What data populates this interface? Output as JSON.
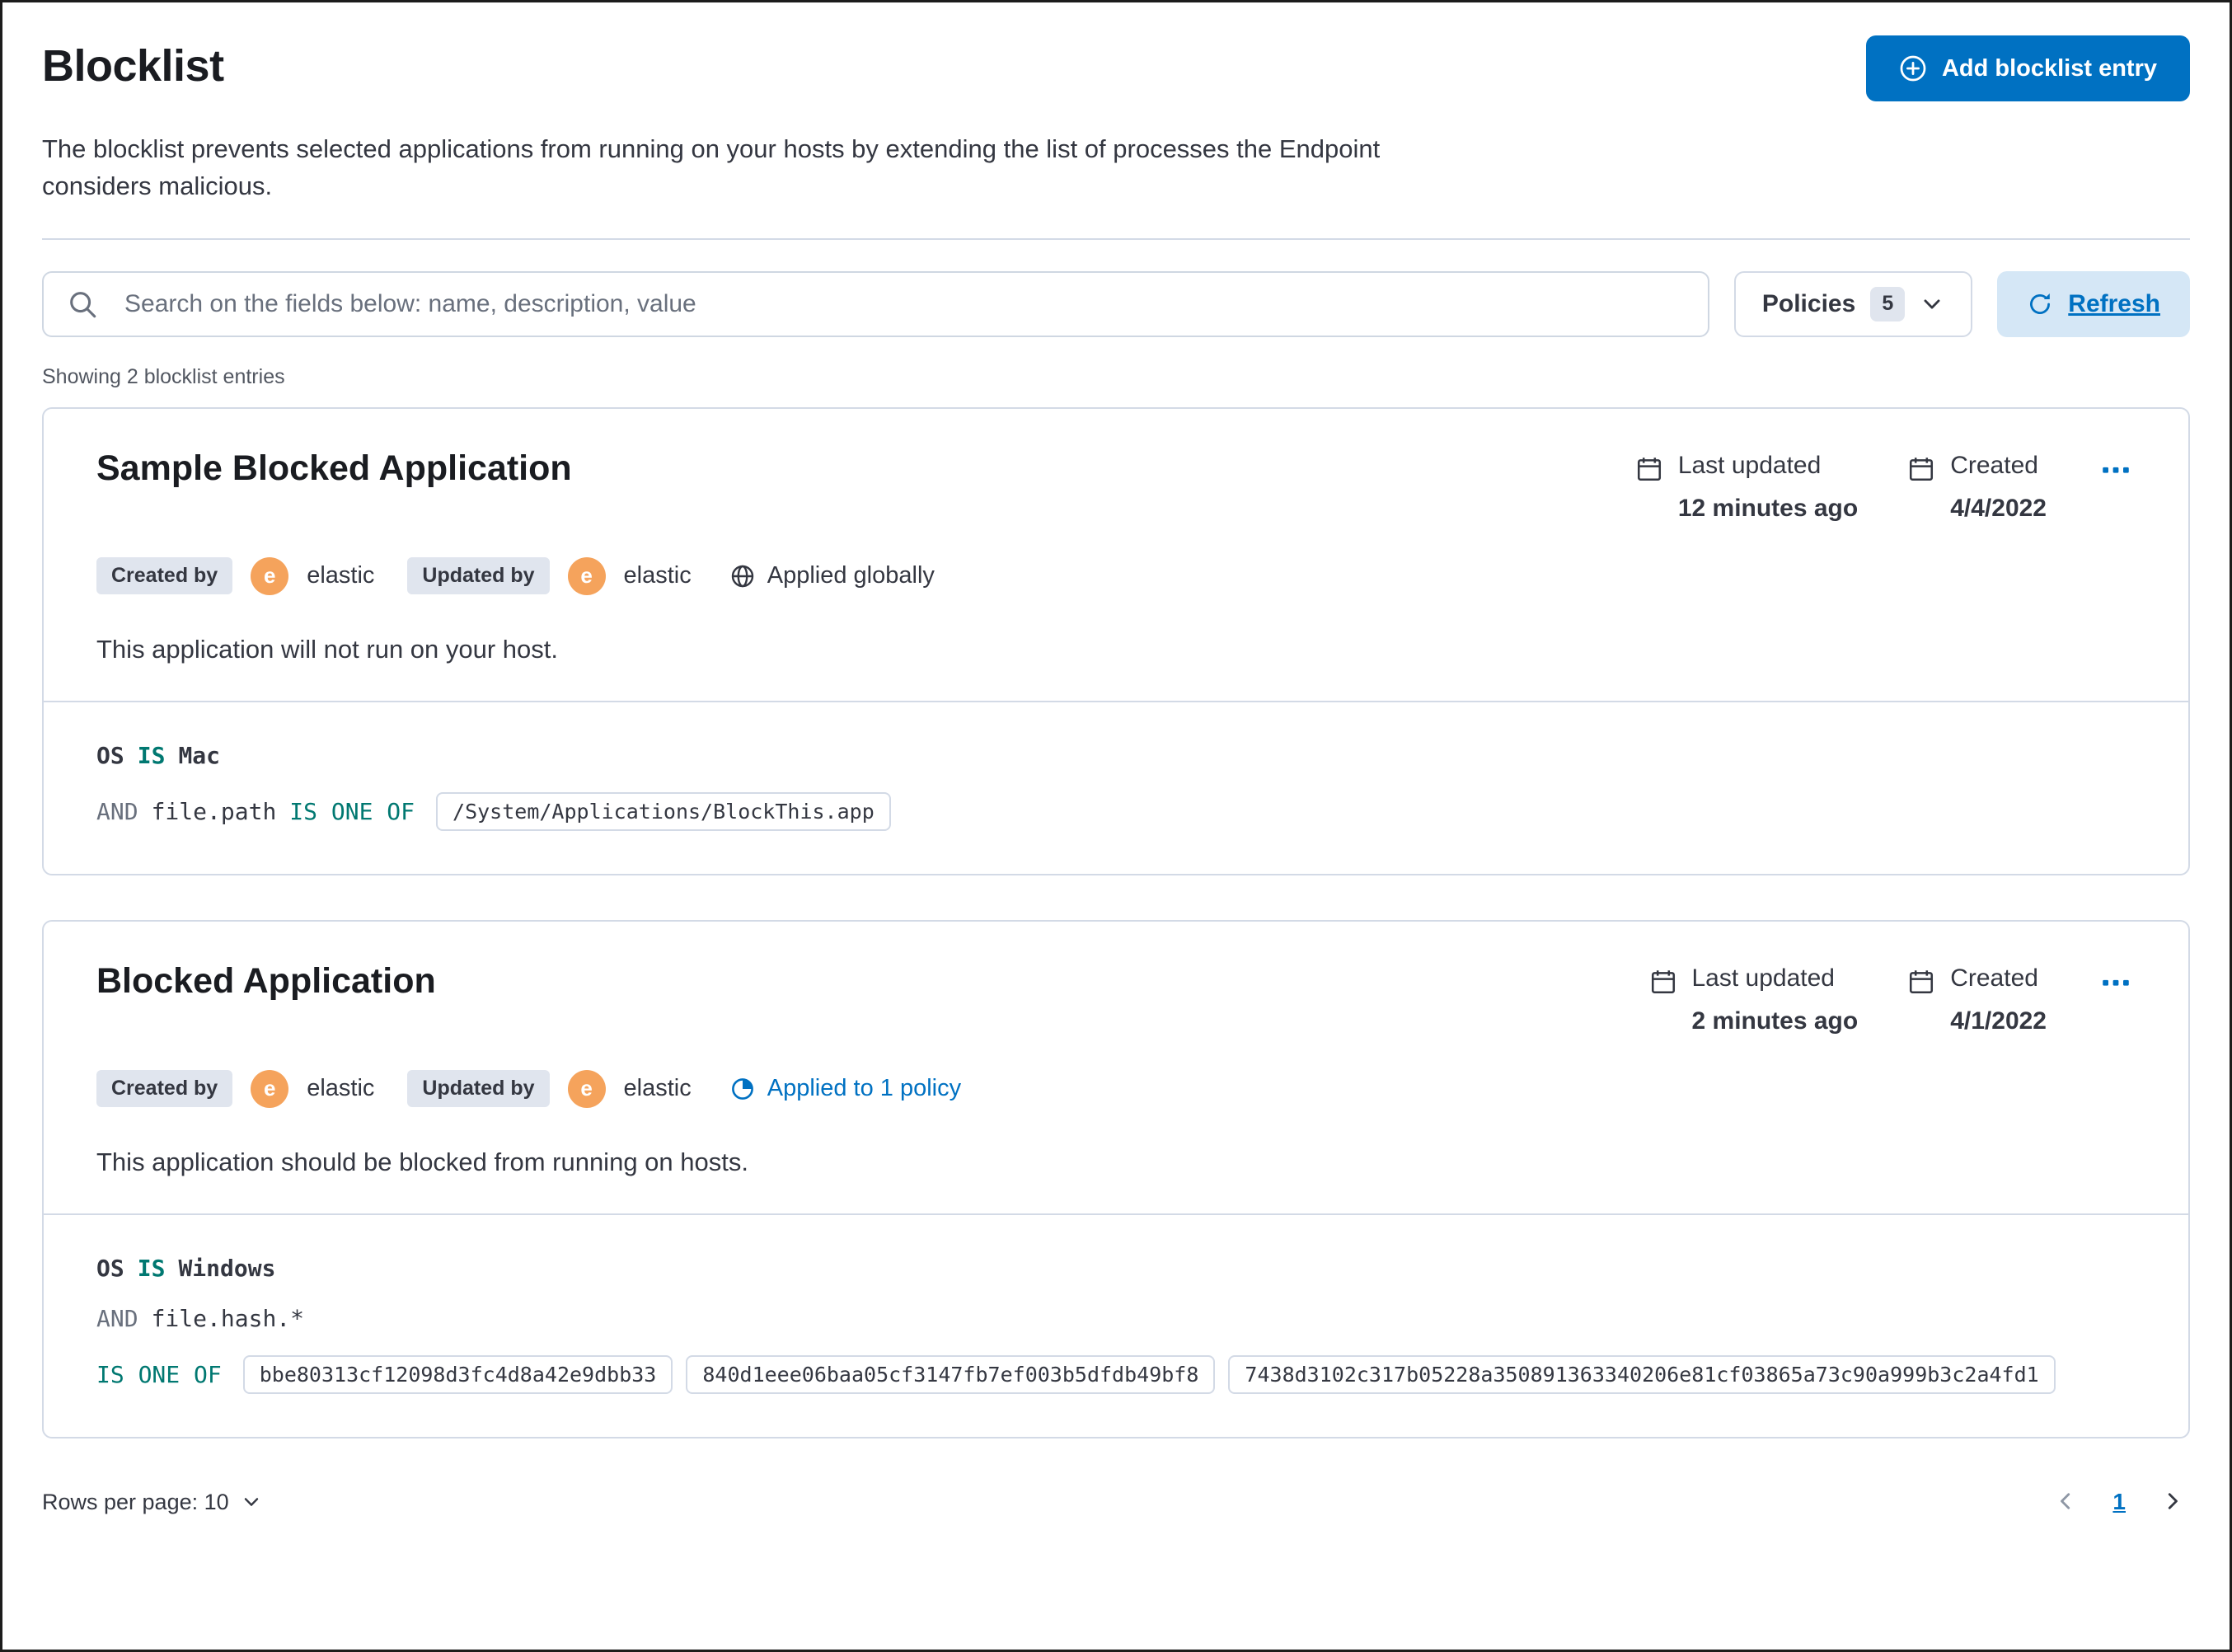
{
  "header": {
    "title": "Blocklist",
    "description": "The blocklist prevents selected applications from running on your hosts by extending the list of processes the Endpoint considers malicious.",
    "add_button_label": "Add blocklist entry"
  },
  "toolbar": {
    "search_placeholder": "Search on the fields below: name, description, value",
    "policies_label": "Policies",
    "policies_count": "5",
    "refresh_label": "Refresh"
  },
  "list": {
    "showing_text": "Showing 2 blocklist entries"
  },
  "colors": {
    "primary_blue": "#0071C2",
    "avatar_orange": "#F5A35C",
    "operator_teal": "#007871",
    "badge_gray": "#E0E5EE",
    "card_border": "#D3DAE6"
  },
  "entries": [
    {
      "title": "Sample Blocked Application",
      "created_by_label": "Created by",
      "created_by_user": "elastic",
      "updated_by_label": "Updated by",
      "updated_by_user": "elastic",
      "avatar_initial": "e",
      "scope_text": "Applied globally",
      "last_updated_label": "Last updated",
      "last_updated_value": "12 minutes ago",
      "created_label": "Created",
      "created_value": "4/4/2022",
      "description": "This application will not run on your host.",
      "criteria": {
        "os_field": "OS",
        "os_operator": "IS",
        "os_value": "Mac",
        "conjunction": "AND",
        "field": "file.path",
        "operator": "IS ONE OF",
        "values": [
          "/System/Applications/BlockThis.app"
        ]
      }
    },
    {
      "title": "Blocked Application",
      "created_by_label": "Created by",
      "created_by_user": "elastic",
      "updated_by_label": "Updated by",
      "updated_by_user": "elastic",
      "avatar_initial": "e",
      "scope_text": "Applied to 1 policy",
      "last_updated_label": "Last updated",
      "last_updated_value": "2 minutes ago",
      "created_label": "Created",
      "created_value": "4/1/2022",
      "description": "This application should be blocked from running on hosts.",
      "criteria": {
        "os_field": "OS",
        "os_operator": "IS",
        "os_value": "Windows",
        "conjunction": "AND",
        "field": "file.hash.*",
        "operator": "IS ONE OF",
        "values": [
          "bbe80313cf12098d3fc4d8a42e9dbb33",
          "840d1eee06baa05cf3147fb7ef003b5dfdb49bf8",
          "7438d3102c317b05228a350891363340206e81cf03865a73c90a999b3c2a4fd1"
        ]
      }
    }
  ],
  "footer": {
    "rows_per_page_label": "Rows per page: 10",
    "page_number": "1"
  }
}
